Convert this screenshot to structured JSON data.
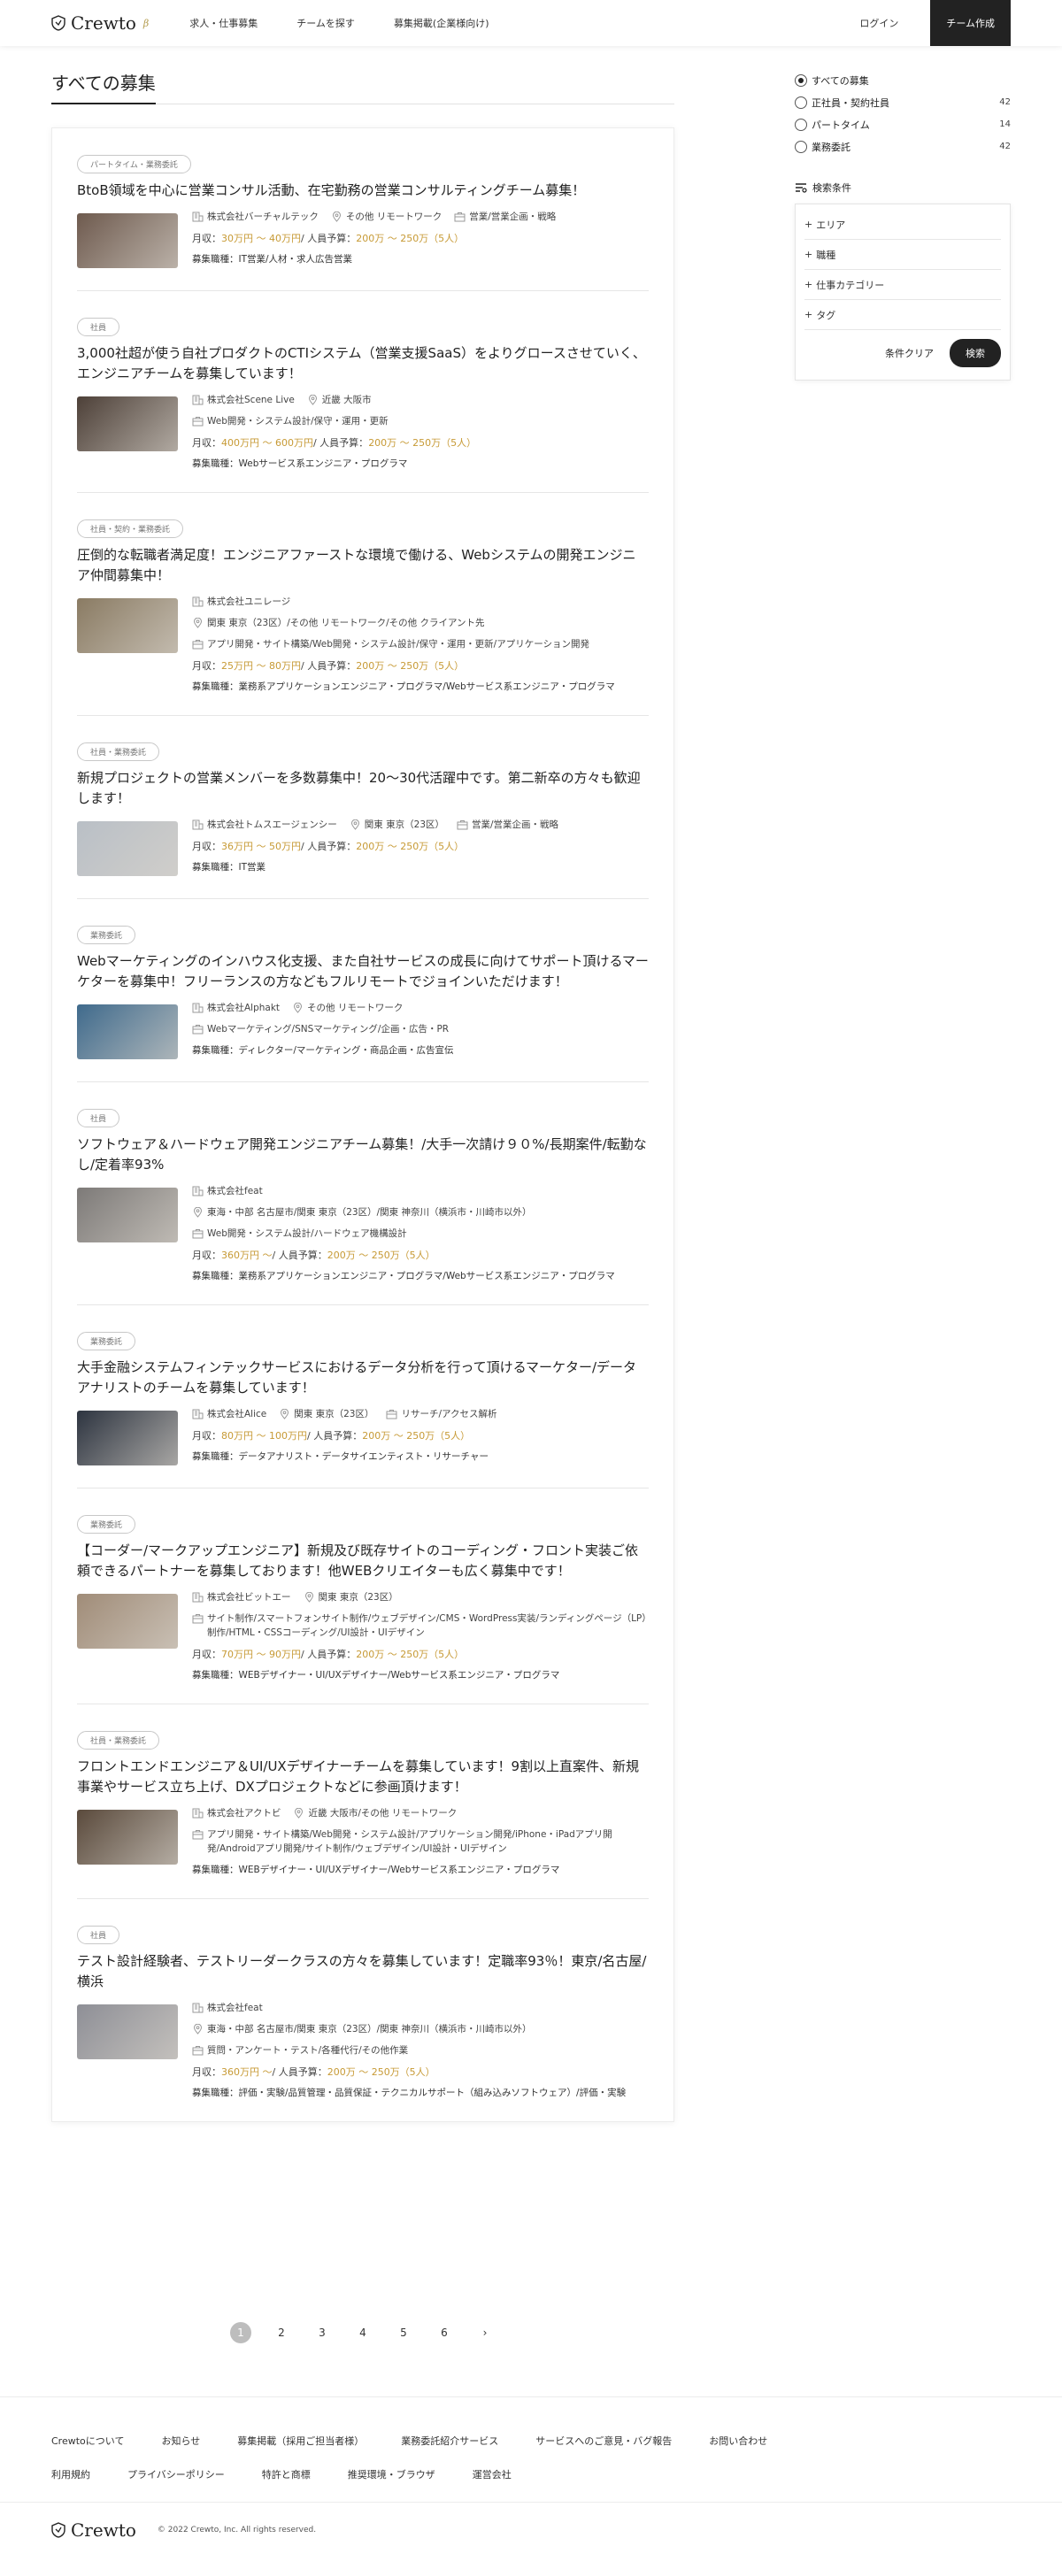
{
  "header": {
    "logo": "Crewto",
    "beta": "β",
    "nav": [
      "求人・仕事募集",
      "チームを探す",
      "募集掲載(企業様向け)"
    ],
    "login": "ログイン",
    "team_create": "チーム作成"
  },
  "page_title": "すべての募集",
  "jobs": [
    {
      "tag": "パートタイム・業務委託",
      "title": "BtoB領域を中心に営業コンサル活動、在宅勤務の営業コンサルティングチーム募集！",
      "company": "株式会社バーチャルテック",
      "location": "その他 リモートワーク",
      "category": "営業/営業企画・戦略",
      "salary_label": "月収：",
      "salary": "30万円 〜 40万円",
      "budget_label": "/ 人員予算：",
      "budget": "200万 〜 250万（5人）",
      "occupation": "募集職種：IT営業/人材・求人広告営業",
      "thumb_color": "#6e5a4e"
    },
    {
      "tag": "社員",
      "title": "3,000社超が使う自社プロダクトのCTIシステム（営業支援SaaS）をよりグロースさせていく、エンジニアチームを募集しています！",
      "company": "株式会社Scene Live",
      "location": "近畿 大阪市",
      "category": "Web開発・システム設計/保守・運用・更新",
      "salary_label": "月収：",
      "salary": "400万円 〜 600万円",
      "budget_label": "/ 人員予算：",
      "budget": "200万 〜 250万（5人）",
      "occupation": "募集職種：Webサービス系エンジニア・プログラマ",
      "thumb_color": "#4d4038"
    },
    {
      "tag": "社員・契約・業務委託",
      "title": "圧倒的な転職者満足度！エンジニアファーストな環境で働ける、Webシステムの開発エンジニア仲間募集中！",
      "company": "株式会社ユニレージ",
      "location": "関東 東京（23区）/その他 リモートワーク/その他 クライアント先",
      "category": "アプリ開発・サイト構築/Web開発・システム設計/保守・運用・更新/アプリケーション開発",
      "salary_label": "月収：",
      "salary": "25万円 〜 80万円",
      "budget_label": "/ 人員予算：",
      "budget": "200万 〜 250万（5人）",
      "occupation": "募集職種：業務系アプリケーションエンジニア・プログラマ/Webサービス系エンジニア・プログラマ",
      "thumb_color": "#8a7b63"
    },
    {
      "tag": "社員・業務委託",
      "title": "新規プロジェクトの営業メンバーを多数募集中！20～30代活躍中です。第二新卒の方々も歓迎します！",
      "company": "株式会社トムスエージェンシー",
      "location": "関東 東京（23区）",
      "category": "営業/営業企画・戦略",
      "salary_label": "月収：",
      "salary": "36万円 〜 50万円",
      "budget_label": "/ 人員予算：",
      "budget": "200万 〜 250万（5人）",
      "occupation": "募集職種：IT営業",
      "thumb_color": "#b9bfc6"
    },
    {
      "tag": "業務委託",
      "title": "Webマーケティングのインハウス化支援、また自社サービスの成長に向けてサポート頂けるマーケターを募集中！フリーランスの方などもフルリモートでジョインいただけます！",
      "company": "株式会社Alphakt",
      "location": "その他 リモートワーク",
      "category": "Webマーケティング/SNSマーケティング/企画・広告・PR",
      "salary_label": "",
      "salary": "",
      "budget_label": "",
      "budget": "",
      "occupation": "募集職種：ディレクター/マーケティング・商品企画・広告宣伝",
      "thumb_color": "#3f6a8c"
    },
    {
      "tag": "社員",
      "title": "ソフトウェア＆ハードウェア開発エンジニアチーム募集！/大手一次請け９０%/長期案件/転勤なし/定着率93%",
      "company": "株式会社feat",
      "location": "東海・中部 名古屋市/関東 東京（23区）/関東 神奈川（横浜市・川崎市以外）",
      "category": "Web開発・システム設計/ハードウェア機構設計",
      "salary_label": "月収：",
      "salary": "360万円 〜",
      "budget_label": "/ 人員予算：",
      "budget": "200万 〜 250万（5人）",
      "occupation": "募集職種：業務系アプリケーションエンジニア・プログラマ/Webサービス系エンジニア・プログラマ",
      "thumb_color": "#7d7a78"
    },
    {
      "tag": "業務委託",
      "title": "大手金融システムフィンテックサービスにおけるデータ分析を行って頂けるマーケター/データアナリストのチームを募集しています！",
      "company": "株式会社Alice",
      "location": "関東 東京（23区）",
      "category": "リサーチ/アクセス解析",
      "salary_label": "月収：",
      "salary": "80万円 〜 100万円",
      "budget_label": "/ 人員予算：",
      "budget": "200万 〜 250万（5人）",
      "occupation": "募集職種：データアナリスト・データサイエンティスト・リサーチャー",
      "thumb_color": "#2d3440"
    },
    {
      "tag": "業務委託",
      "title": "【コーダー/マークアップエンジニア】新規及び既存サイトのコーディング・フロント実装ご依頼できるパートナーを募集しております！他WEBクリエイターも広く募集中です！",
      "company": "株式会社ビットエー",
      "location": "関東 東京（23区）",
      "category": "サイト制作/スマートフォンサイト制作/ウェブデザイン/CMS・WordPress実装/ランディングページ（LP）制作/HTML・CSSコーディング/UI設計・UIデザイン",
      "salary_label": "月収：",
      "salary": "70万円 〜 90万円",
      "budget_label": "/ 人員予算：",
      "budget": "200万 〜 250万（5人）",
      "occupation": "募集職種：WEBデザイナー・UI/UXデザイナー/Webサービス系エンジニア・プログラマ",
      "thumb_color": "#a08c78"
    },
    {
      "tag": "社員・業務委託",
      "title": "フロントエンドエンジニア＆UI/UXデザイナーチームを募集しています！9割以上直案件、新規事業やサービス立ち上げ、DXプロジェクトなどに参画頂けます！",
      "company": "株式会社アクトビ",
      "location": "近畿 大阪市/その他 リモートワーク",
      "category": "アプリ開発・サイト構築/Web開発・システム設計/アプリケーション開発/iPhone・iPadアプリ開発/Androidアプリ開発/サイト制作/ウェブデザイン/UI設計・UIデザイン",
      "salary_label": "",
      "salary": "",
      "budget_label": "",
      "budget": "",
      "occupation": "募集職種：WEBデザイナー・UI/UXデザイナー/Webサービス系エンジニア・プログラマ",
      "thumb_color": "#5a4a3c"
    },
    {
      "tag": "社員",
      "title": "テスト設計経験者、テストリーダークラスの方々を募集しています！定職率93％！東京/名古屋/横浜",
      "company": "株式会社feat",
      "location": "東海・中部 名古屋市/関東 東京（23区）/関東 神奈川（横浜市・川崎市以外）",
      "category": "質問・アンケート・テスト/各種代行/その他作業",
      "salary_label": "月収：",
      "salary": "360万円 〜",
      "budget_label": "/ 人員予算：",
      "budget": "200万 〜 250万（5人）",
      "occupation": "募集職種：評価・実験/品質管理・品質保証・テクニカルサポート（組み込みソフトウェア）/評価・実験",
      "thumb_color": "#8e8f96"
    }
  ],
  "pagination": [
    "1",
    "2",
    "3",
    "4",
    "5",
    "6",
    "›"
  ],
  "sidebar": {
    "types": [
      {
        "label": "すべての募集",
        "count": ""
      },
      {
        "label": "正社員・契約社員",
        "count": "42"
      },
      {
        "label": "パートタイム",
        "count": "14"
      },
      {
        "label": "業務委託",
        "count": "42"
      }
    ],
    "search_label": "検索条件",
    "filters": [
      "エリア",
      "職種",
      "仕事カテゴリー",
      "タグ"
    ],
    "clear": "条件クリア",
    "search": "検索"
  },
  "footer": {
    "links": [
      "Crewtoについて",
      "お知らせ",
      "募集掲載（採用ご担当者様）",
      "業務委託紹介サービス",
      "サービスへのご意見・バグ報告",
      "お問い合わせ",
      "利用規約",
      "プライバシーポリシー",
      "特許と商標",
      "推奨環境・ブラウザ",
      "運営会社"
    ],
    "logo": "Crewto",
    "copyright": "© 2022 Crewto, Inc. All rights reserved."
  }
}
